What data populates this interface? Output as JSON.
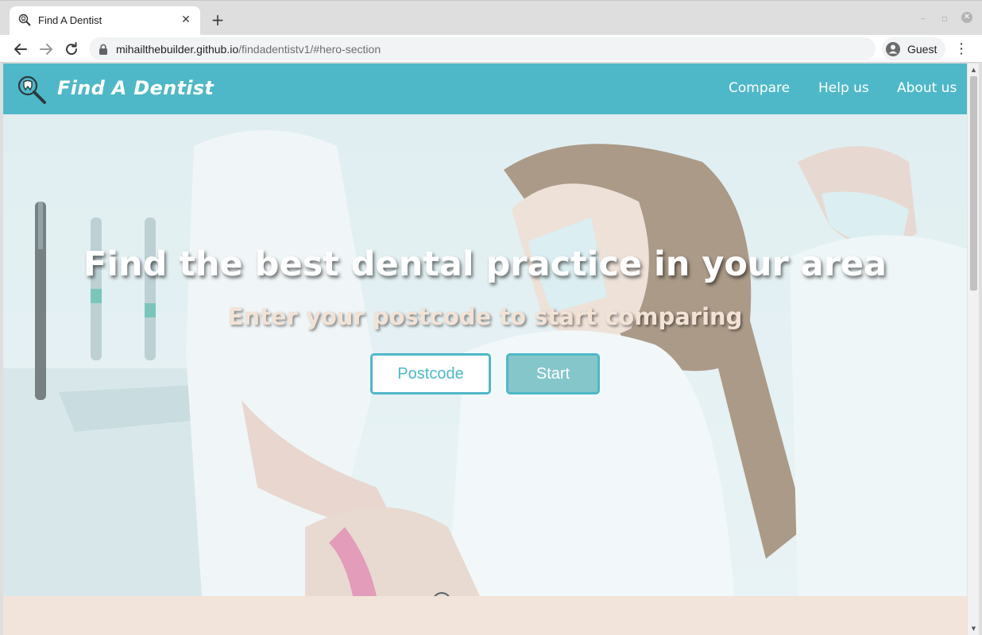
{
  "browser": {
    "tab_title": "Find A Dentist",
    "url_host": "mihailthebuilder.github.io",
    "url_path": "/findadentistv1/#hero-section",
    "profile_label": "Guest"
  },
  "site": {
    "brand": "Find A Dentist",
    "nav": [
      "Compare",
      "Help us",
      "About us"
    ],
    "accent_color": "#4fb8c8"
  },
  "hero": {
    "title": "Find the best dental practice in your area",
    "subtitle": "Enter your postcode to start comparing",
    "postcode_placeholder": "Postcode",
    "start_label": "Start"
  },
  "icons": {
    "tab_favicon": "magnifier-tooth-icon",
    "logo": "magnifier-tooth-icon",
    "back": "arrow-left-icon",
    "forward": "arrow-right-icon",
    "reload": "reload-icon",
    "lock": "lock-icon",
    "profile": "person-icon",
    "menu": "kebab-menu-icon"
  }
}
